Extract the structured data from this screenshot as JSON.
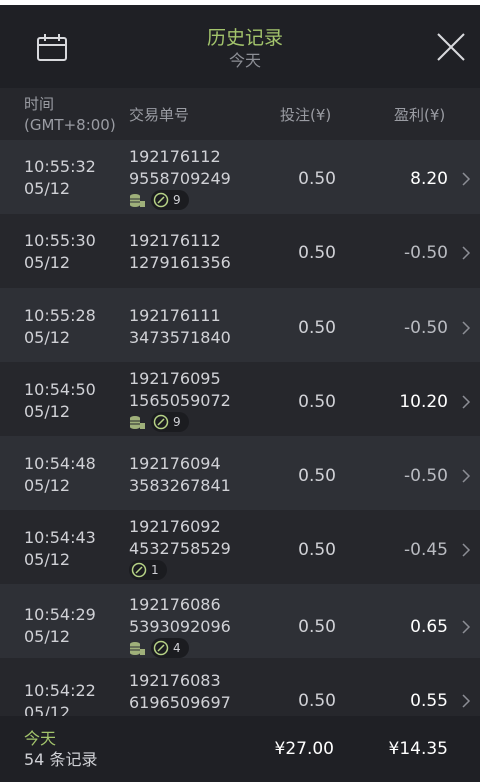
{
  "header": {
    "title": "历史记录",
    "subtitle": "今天",
    "calendar_icon": "calendar-icon",
    "close_icon": "close-icon"
  },
  "columns": {
    "time_line1": "时间",
    "time_line2": "(GMT+8:00)",
    "order": "交易单号",
    "stake": "投注(¥)",
    "profit": "盈利(¥)"
  },
  "rows": [
    {
      "time": "10:55:32",
      "date": "05/12",
      "order1": "192176112",
      "order2": "9558709249",
      "stake": "0.50",
      "profit": "8.20",
      "coins": true,
      "ball_count": "9"
    },
    {
      "time": "10:55:30",
      "date": "05/12",
      "order1": "192176112",
      "order2": "1279161356",
      "stake": "0.50",
      "profit": "-0.50"
    },
    {
      "time": "10:55:28",
      "date": "05/12",
      "order1": "192176111",
      "order2": "3473571840",
      "stake": "0.50",
      "profit": "-0.50"
    },
    {
      "time": "10:54:50",
      "date": "05/12",
      "order1": "192176095",
      "order2": "1565059072",
      "stake": "0.50",
      "profit": "10.20",
      "coins": true,
      "ball_count": "9"
    },
    {
      "time": "10:54:48",
      "date": "05/12",
      "order1": "192176094",
      "order2": "3583267841",
      "stake": "0.50",
      "profit": "-0.50"
    },
    {
      "time": "10:54:43",
      "date": "05/12",
      "order1": "192176092",
      "order2": "4532758529",
      "stake": "0.50",
      "profit": "-0.45",
      "ball_count": "1"
    },
    {
      "time": "10:54:29",
      "date": "05/12",
      "order1": "192176086",
      "order2": "5393092096",
      "stake": "0.50",
      "profit": "0.65",
      "coins": true,
      "ball_count": "4"
    },
    {
      "time": "10:54:22",
      "date": "05/12",
      "order1": "192176083",
      "order2": "6196509697",
      "stake": "0.50",
      "profit": "0.55"
    }
  ],
  "footer": {
    "label": "今天",
    "count": "54 条记录",
    "total_stake": "¥27.00",
    "total_profit": "¥14.35"
  },
  "colors": {
    "accent": "#a3c46c",
    "background": "#26272c",
    "row_alt": "#2e3036",
    "header_bg": "#1f2025"
  }
}
